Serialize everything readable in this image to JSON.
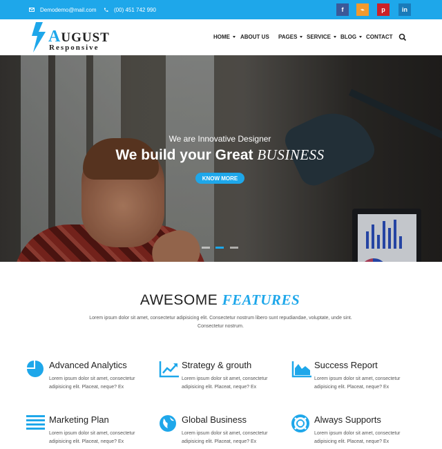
{
  "topbar": {
    "email": "Demodemo@mail.com",
    "phone": "(00) 451 742 990",
    "social": [
      {
        "name": "facebook-icon",
        "glyph": "f",
        "color": "#3b5998"
      },
      {
        "name": "rss-icon",
        "glyph": "⌁",
        "color": "#f29a2e"
      },
      {
        "name": "pinterest-icon",
        "glyph": "p",
        "color": "#cb2027"
      },
      {
        "name": "linkedin-icon",
        "glyph": "in",
        "color": "#1a7bb9"
      }
    ],
    "accent": "#1ea7ea"
  },
  "logo": {
    "first_letter": "A",
    "rest": "UGUST",
    "subtitle": "Responsive"
  },
  "nav": {
    "items": [
      {
        "label": "HOME",
        "dropdown": true
      },
      {
        "label": "ABOUT US",
        "dropdown": false
      },
      {
        "label": "PAGES",
        "dropdown": true
      },
      {
        "label": "SERVICE",
        "dropdown": true
      },
      {
        "label": "BLOG",
        "dropdown": true
      },
      {
        "label": "CONTACT",
        "dropdown": false
      }
    ],
    "search_icon": "search-icon"
  },
  "hero": {
    "kicker": "We are Innovative Designer",
    "title_plain": "We build your Great ",
    "title_italic": "BUSINESS",
    "button": "KNOW MORE",
    "slide_count": 3,
    "active_slide": 2
  },
  "features": {
    "title_plain": "AWESOME ",
    "title_italic": "FEATURES",
    "description": "Lorem ipsum dolor sit amet, consectetur adipisicing elit. Consectetur nostrum libero sunt repudiandae, voluptate, unde sint. Consectetur nostrum.",
    "items": [
      {
        "icon": "pie-chart-icon",
        "title": "Advanced Analytics",
        "text": "Lorem ipsum dolor sit amet, consectetur adipisicing elit. Placeat, neque? Ex"
      },
      {
        "icon": "line-chart-icon",
        "title": "Strategy & grouth",
        "text": "Lorem ipsum dolor sit amet, consectetur adipisicing elit. Placeat, neque? Ex"
      },
      {
        "icon": "area-chart-icon",
        "title": "Success Report",
        "text": "Lorem ipsum dolor sit amet, consectetur adipisicing elit. Placeat, neque? Ex"
      },
      {
        "icon": "list-icon",
        "title": "Marketing Plan",
        "text": "Lorem ipsum dolor sit amet, consectetur adipisicing elit. Placeat, neque? Ex"
      },
      {
        "icon": "globe-icon",
        "title": "Global Business",
        "text": "Lorem ipsum dolor sit amet, consectetur adipisicing elit. Placeat, neque? Ex"
      },
      {
        "icon": "lifebuoy-icon",
        "title": "Always Supports",
        "text": "Lorem ipsum dolor sit amet, consectetur adipisicing elit. Placeat, neque? Ex"
      }
    ]
  }
}
